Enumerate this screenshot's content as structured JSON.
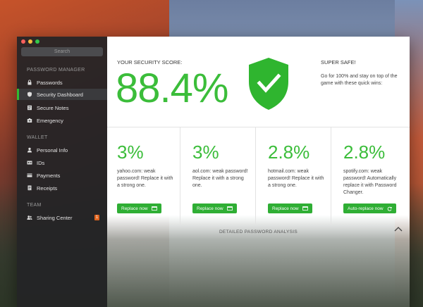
{
  "sidebar": {
    "search_placeholder": "Search",
    "sections": {
      "password_manager": "PASSWORD MANAGER",
      "wallet": "WALLET",
      "team": "TEAM"
    },
    "items": [
      {
        "label": "Passwords",
        "icon": "lock-icon"
      },
      {
        "label": "Security Dashboard",
        "icon": "shield-icon"
      },
      {
        "label": "Secure Notes",
        "icon": "note-icon"
      },
      {
        "label": "Emergency",
        "icon": "emergency-icon"
      },
      {
        "label": "Personal Info",
        "icon": "person-icon"
      },
      {
        "label": "IDs",
        "icon": "id-card-icon"
      },
      {
        "label": "Payments",
        "icon": "card-icon"
      },
      {
        "label": "Receipts",
        "icon": "receipt-icon"
      },
      {
        "label": "Sharing Center",
        "icon": "people-icon",
        "badge": "1"
      }
    ]
  },
  "score": {
    "label": "YOUR SECURITY SCORE:",
    "value": "88.4%"
  },
  "safe": {
    "title": "SUPER SAFE!",
    "description": "Go for 100% and stay on top of the game with these quick wins:"
  },
  "cards": [
    {
      "percent": "3%",
      "text": "yahoo.com: weak password! Replace it with a strong one.",
      "button": "Replace now"
    },
    {
      "percent": "3%",
      "text": "aol.com: weak password! Replace it with a strong one.",
      "button": "Replace now"
    },
    {
      "percent": "2.8%",
      "text": "hotmail.com: weak password! Replace it with a strong one.",
      "button": "Replace now"
    },
    {
      "percent": "2.8%",
      "text": "spotify.com: weak password! Automatically replace it with Password Changer.",
      "button": "Auto-replace now"
    }
  ],
  "detail": {
    "label": "DETAILED PASSWORD ANALYSIS"
  },
  "colors": {
    "accent": "#3bbd3a",
    "button": "#2fae34",
    "badge": "#e0641e"
  }
}
